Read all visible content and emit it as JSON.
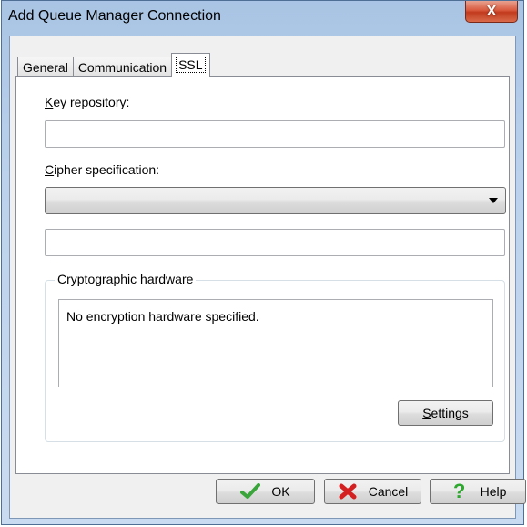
{
  "window": {
    "title": "Add Queue Manager Connection",
    "close_glyph": "X"
  },
  "tabs": [
    {
      "label": "General",
      "active": false
    },
    {
      "label": "Communication",
      "active": false
    },
    {
      "label": "SSL",
      "active": true
    }
  ],
  "ssl": {
    "key_repository": {
      "label_mnemonic": "K",
      "label_rest": "ey repository:",
      "value": ""
    },
    "cipher_spec": {
      "label_mnemonic": "C",
      "label_rest": "ipher specification:",
      "selected": "",
      "extra_value": ""
    },
    "crypto_hardware": {
      "group_label": "Cryptographic hardware",
      "text": "No encryption hardware specified.",
      "settings_mnemonic": "S",
      "settings_rest": "ettings"
    }
  },
  "buttons": {
    "ok": {
      "label": "OK",
      "icon": "checkmark-icon"
    },
    "cancel": {
      "label": "Cancel",
      "icon": "cross-icon"
    },
    "help": {
      "label": "Help",
      "icon": "question-icon"
    }
  },
  "colors": {
    "ok_icon": "#3aa53a",
    "cancel_icon": "#d42020",
    "help_icon": "#2ea82e"
  }
}
